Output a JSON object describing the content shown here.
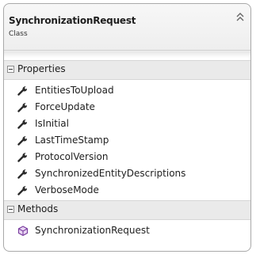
{
  "class_box": {
    "name": "SynchronizationRequest",
    "stereotype": "Class",
    "sections": [
      {
        "label": "Properties",
        "members": [
          {
            "name": "EntitiesToUpload",
            "icon": "wrench-property-icon"
          },
          {
            "name": "ForceUpdate",
            "icon": "wrench-property-icon"
          },
          {
            "name": "IsInitial",
            "icon": "wrench-property-icon"
          },
          {
            "name": "LastTimeStamp",
            "icon": "wrench-property-icon"
          },
          {
            "name": "ProtocolVersion",
            "icon": "wrench-property-icon"
          },
          {
            "name": "SynchronizedEntityDescriptions",
            "icon": "wrench-property-icon"
          },
          {
            "name": "VerboseMode",
            "icon": "wrench-property-icon"
          }
        ]
      },
      {
        "label": "Methods",
        "members": [
          {
            "name": "SynchronizationRequest",
            "icon": "method-cube-icon"
          }
        ]
      }
    ]
  },
  "colors": {
    "border": "#a9a9a9",
    "section_bg": "#eaeaea",
    "method_icon": "#7b3fa0",
    "wrench_icon": "#2b2b2b"
  }
}
